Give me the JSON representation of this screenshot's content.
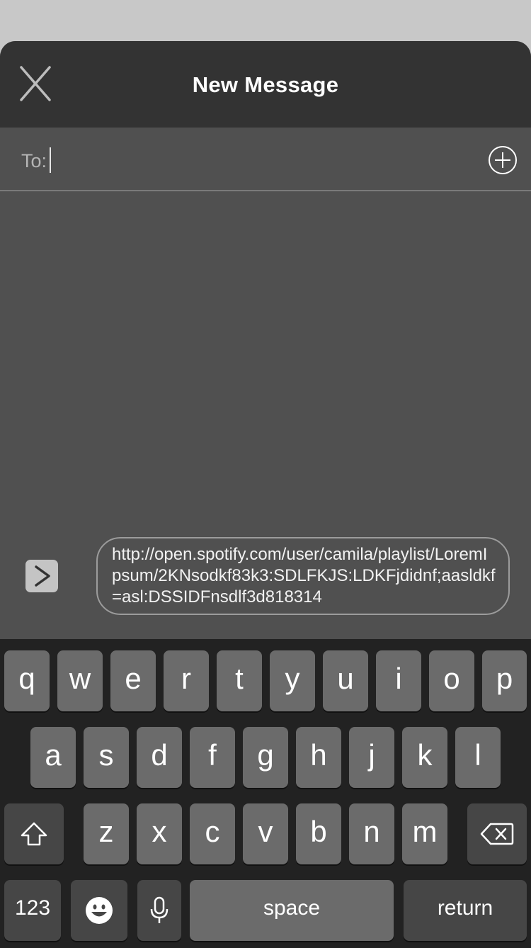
{
  "header": {
    "title": "New Message",
    "close_icon": "close-icon"
  },
  "recipient": {
    "label": "To:",
    "value": "",
    "add_icon": "add-contact-icon"
  },
  "composer": {
    "expand_icon": "chevron-right-icon",
    "message_text": "http://open.spotify.com/user/camila/playlist/LoremIpsum/2KNsodkf83k3:SDLFKJS:LDKFjdidnf;aasldkf=asl:DSSIDFnsdlf3d818314"
  },
  "keyboard": {
    "row1": [
      "q",
      "w",
      "e",
      "r",
      "t",
      "y",
      "u",
      "i",
      "o",
      "p"
    ],
    "row2": [
      "a",
      "s",
      "d",
      "f",
      "g",
      "h",
      "j",
      "k",
      "l"
    ],
    "row3": [
      "z",
      "x",
      "c",
      "v",
      "b",
      "n",
      "m"
    ],
    "numbers_label": "123",
    "space_label": "space",
    "return_label": "return",
    "icons": [
      "shift-icon",
      "backspace-icon",
      "emoji-icon",
      "microphone-icon"
    ]
  },
  "colors": {
    "header_bg": "#333333",
    "body_bg": "#505050",
    "keyboard_bg": "#222222",
    "key_bg": "#6b6b6b",
    "key_dark_bg": "#464646"
  }
}
